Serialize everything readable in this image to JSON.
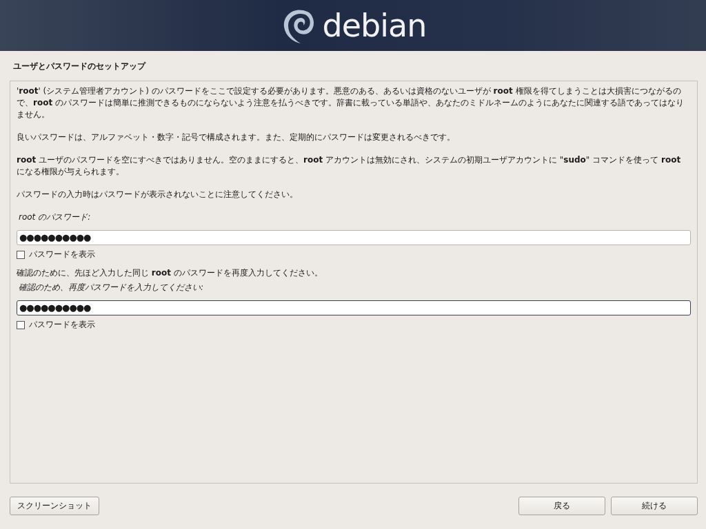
{
  "header": {
    "logo_text": "debian"
  },
  "page_title": "ユーザとパスワードのセットアップ",
  "paragraphs": [
    "'**root**' (システム管理者アカウント) のパスワードをここで設定する必要があります。悪意のある、あるいは資格のないユーザが **root** 権限を得てしまうことは大損害につながるので、**root** のパスワードは簡単に推測できるものにならないよう注意を払うべきです。辞書に載っている単語や、あなたのミドルネームのようにあなたに関連する語であってはなりません。",
    "良いパスワードは、アルファベット・数字・記号で構成されます。また、定期的にパスワードは変更されるべきです。",
    "**root** ユーザのパスワードを空にすべきではありません。空のままにすると、**root** アカウントは無効にされ、システムの初期ユーザアカウントに \"**sudo**\" コマンドを使って **root** になる権限が与えられます。",
    "パスワードの入力時はパスワードが表示されないことに注意してください。"
  ],
  "fields": [
    {
      "label": "root のパスワード:",
      "value": "●●●●●●●●●●",
      "focused": false,
      "show_password": {
        "label": "パスワードを表示",
        "checked": false
      }
    },
    {
      "intro": "確認のために、先ほど入力した同じ **root** のパスワードを再度入力してください。",
      "label": "確認のため、再度パスワードを入力してください:",
      "value": "●●●●●●●●●●",
      "focused": true,
      "show_password": {
        "label": "パスワードを表示",
        "checked": false
      }
    }
  ],
  "buttons": {
    "screenshot": "スクリーンショット",
    "back": "戻る",
    "continue": "続ける"
  }
}
